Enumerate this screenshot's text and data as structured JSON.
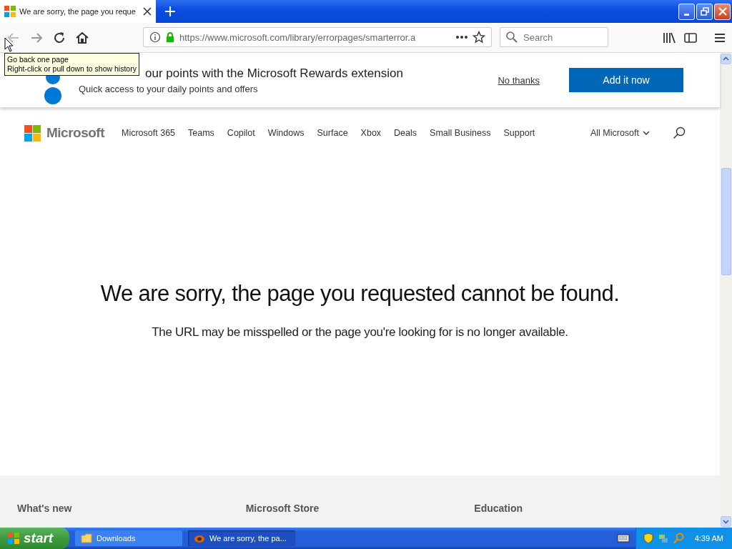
{
  "browser": {
    "tab": {
      "title": "We are sorry, the page you reque",
      "selected": true
    },
    "address": "https://www.microsoft.com/library/errorpages/smarterror.a",
    "search": {
      "placeholder": "Search"
    },
    "tooltip": [
      "Go back one page",
      "Right-click or pull down to show history"
    ]
  },
  "banner": {
    "title": "our points with the Microsoft Rewards extension",
    "subtitle": "Quick access to your daily points and offers",
    "dismiss": "No thanks",
    "action": "Add it now"
  },
  "nav": {
    "logo": "Microsoft",
    "items": [
      "Microsoft 365",
      "Teams",
      "Copilot",
      "Windows",
      "Surface",
      "Xbox",
      "Deals",
      "Small Business",
      "Support"
    ],
    "all": "All Microsoft"
  },
  "error": {
    "heading": "We are sorry, the page you requested cannot be found.",
    "message": "The URL may be misspelled or the page you're looking for is no longer available."
  },
  "footer": {
    "columns": [
      "What's new",
      "Microsoft Store",
      "Education"
    ]
  },
  "taskbar": {
    "start": "start",
    "tasks": [
      {
        "label": "Downloads",
        "kind": "folder",
        "selected": false
      },
      {
        "label": "We are sorry, the pa...",
        "kind": "browser",
        "selected": true
      }
    ],
    "clock": "4:39 AM"
  }
}
